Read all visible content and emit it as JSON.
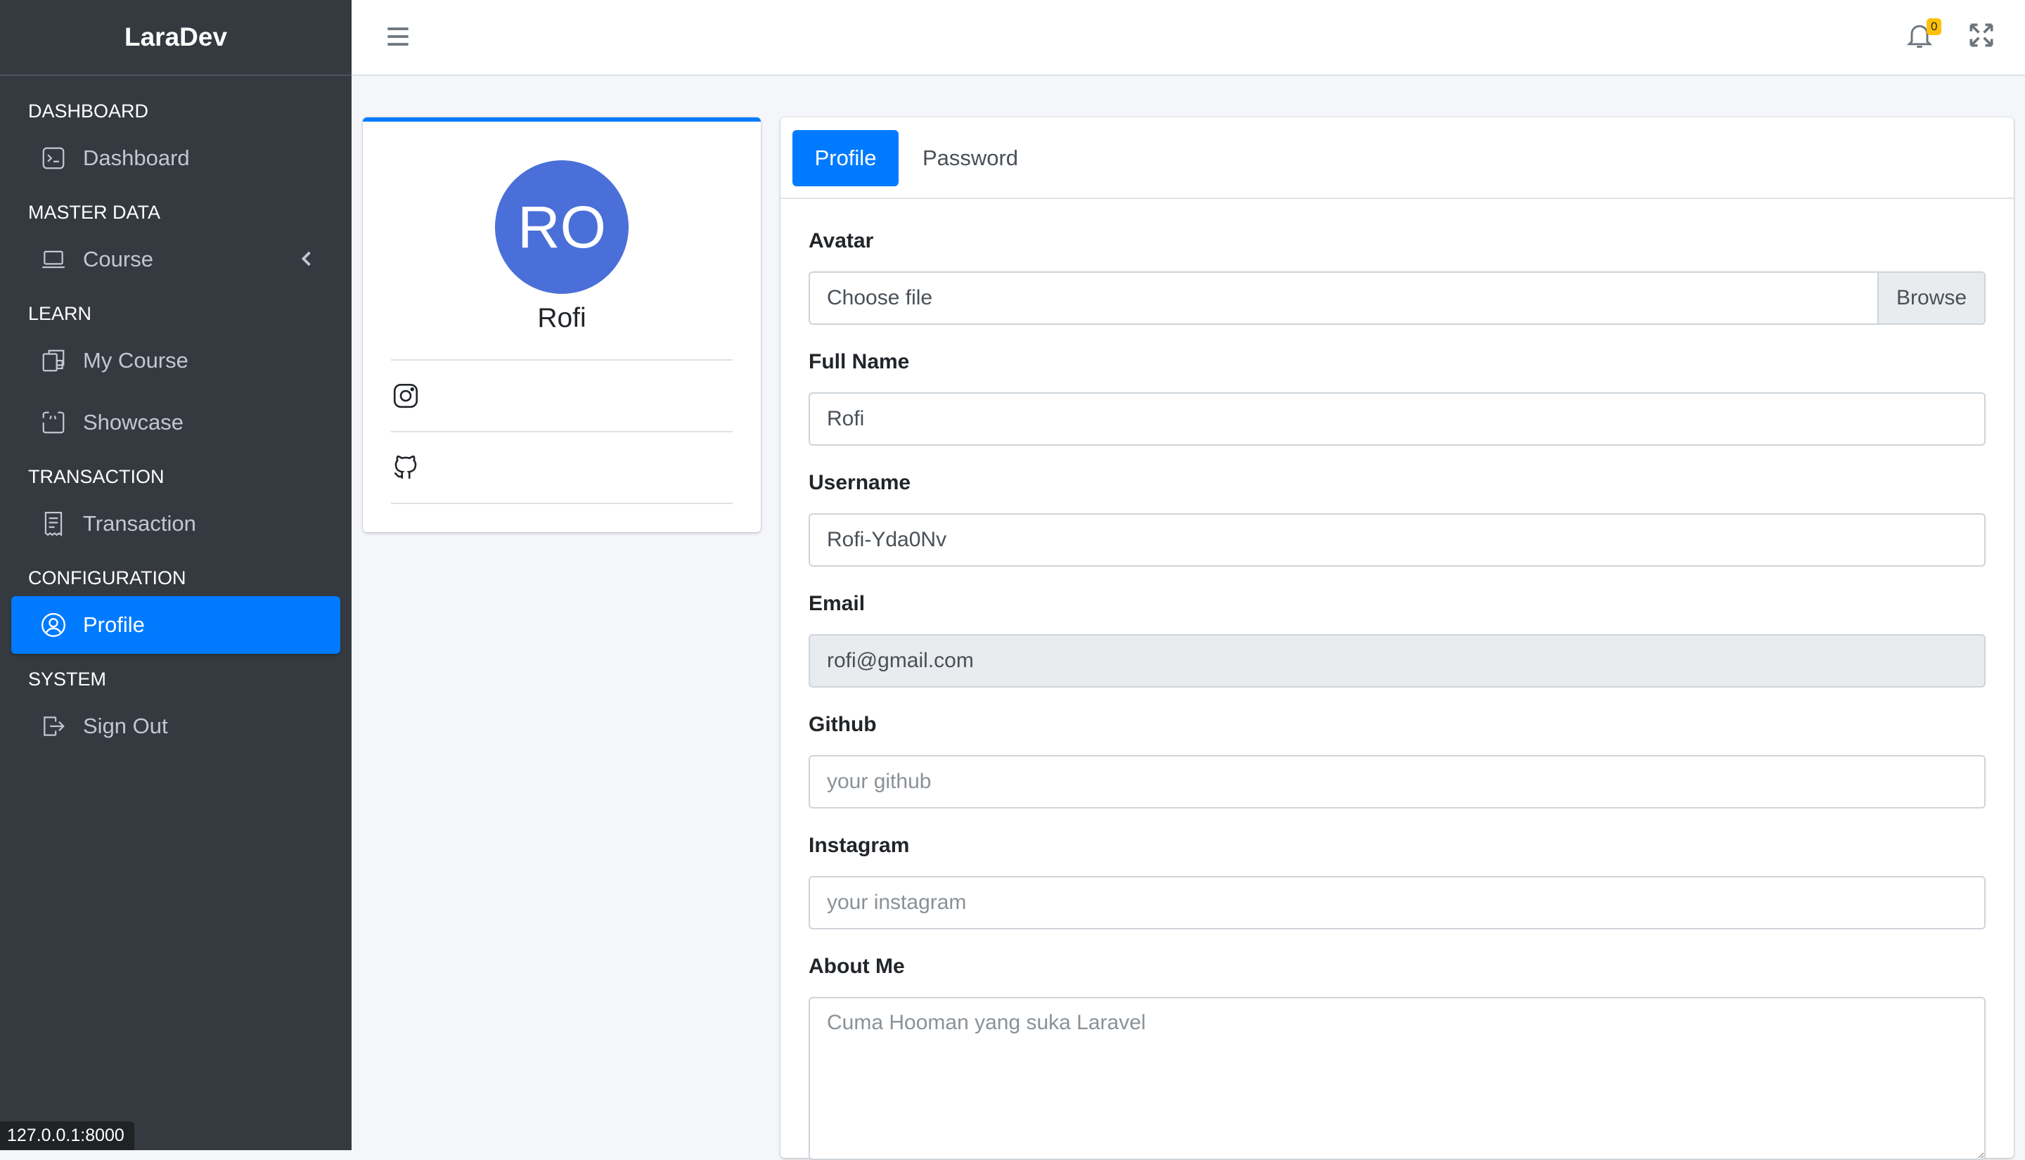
{
  "brand": "LaraDev",
  "sidebar": {
    "sections": [
      {
        "header": "DASHBOARD",
        "items": [
          {
            "label": "Dashboard",
            "icon": "terminal-icon"
          }
        ]
      },
      {
        "header": "MASTER DATA",
        "items": [
          {
            "label": "Course",
            "icon": "laptop-icon",
            "expandable": true
          }
        ]
      },
      {
        "header": "LEARN",
        "items": [
          {
            "label": "My Course",
            "icon": "copy-icon"
          },
          {
            "label": "Showcase",
            "icon": "code-square-icon"
          }
        ]
      },
      {
        "header": "TRANSACTION",
        "items": [
          {
            "label": "Transaction",
            "icon": "receipt-icon"
          }
        ]
      },
      {
        "header": "CONFIGURATION",
        "items": [
          {
            "label": "Profile",
            "icon": "user-circle-icon",
            "active": true
          }
        ]
      },
      {
        "header": "SYSTEM",
        "items": [
          {
            "label": "Sign Out",
            "icon": "sign-out-icon"
          }
        ]
      }
    ]
  },
  "topbar": {
    "notification_count": "0"
  },
  "profile_card": {
    "initials": "RO",
    "name": "Rofi",
    "links": [
      {
        "icon": "instagram-icon"
      },
      {
        "icon": "github-icon"
      }
    ]
  },
  "tabs": {
    "profile": "Profile",
    "password": "Password",
    "active": "Profile"
  },
  "form": {
    "avatar": {
      "label": "Avatar",
      "file_text": "Choose file",
      "browse": "Browse"
    },
    "full_name": {
      "label": "Full Name",
      "value": "Rofi"
    },
    "username": {
      "label": "Username",
      "value": "Rofi-Yda0Nv"
    },
    "email": {
      "label": "Email",
      "value": "rofi@gmail.com"
    },
    "github": {
      "label": "Github",
      "value": "",
      "placeholder": "your github"
    },
    "instagram": {
      "label": "Instagram",
      "value": "",
      "placeholder": "your instagram"
    },
    "about": {
      "label": "About Me",
      "value": "",
      "placeholder": "Cuma Hooman yang suka Laravel"
    }
  },
  "status_bar": {
    "url": "127.0.0.1:8000"
  },
  "colors": {
    "sidebar": "#343a40",
    "accent": "#007bff",
    "avatar": "#4a6fd8",
    "badge": "#ffc107"
  }
}
